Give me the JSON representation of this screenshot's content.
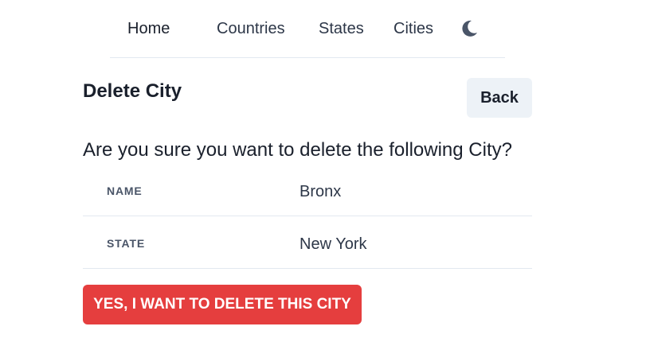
{
  "nav": {
    "home": "Home",
    "countries": "Countries",
    "states": "States",
    "cities": "Cities",
    "theme_icon": "moon-icon"
  },
  "page": {
    "title": "Delete City",
    "back_label": "Back",
    "question": "Are you sure you want to delete the following City?"
  },
  "details": [
    {
      "label": "NAME",
      "value": "Bronx"
    },
    {
      "label": "STATE",
      "value": "New York"
    }
  ],
  "actions": {
    "confirm_label": "YES, I WANT TO DELETE THIS CITY"
  },
  "colors": {
    "danger": "#e53e3e",
    "secondary_bg": "#edf2f7",
    "divider": "#e2e8f0",
    "icon": "#4a5568"
  }
}
